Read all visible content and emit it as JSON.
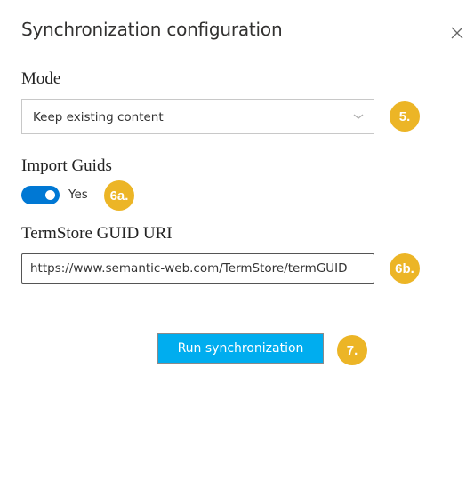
{
  "dialog": {
    "title": "Synchronization configuration",
    "close_icon": "close-icon"
  },
  "mode": {
    "label": "Mode",
    "selected": "Keep existing content",
    "dropdown_icon": "chevron-down-icon",
    "badge": "5."
  },
  "import_guids": {
    "label": "Import Guids",
    "toggle_on": true,
    "toggle_text": "Yes",
    "badge": "6a."
  },
  "termstore_uri": {
    "label": "TermStore GUID URI",
    "value": "https://www.semantic-web.com/TermStore/termGUID",
    "badge": "6b."
  },
  "actions": {
    "run_label": "Run synchronization",
    "badge": "7."
  },
  "colors": {
    "badge": "#ecb526",
    "toggle": "#0078d4",
    "primary_button": "#00adef"
  }
}
